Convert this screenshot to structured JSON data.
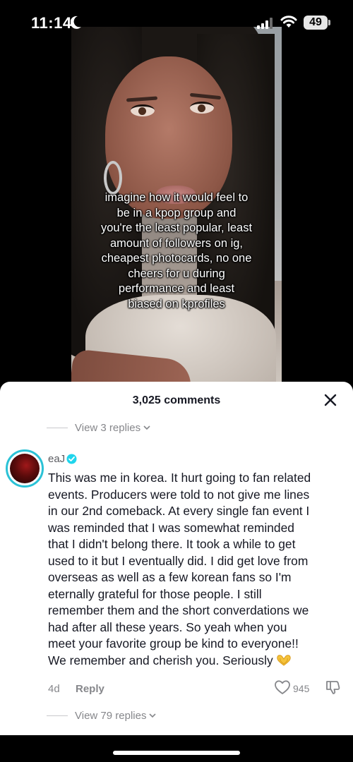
{
  "status_bar": {
    "time": "11:14",
    "battery": "49"
  },
  "video": {
    "caption_lines": [
      "imagine how it would feel to",
      "be in a kpop group and",
      "you're the least popular, least",
      "amount of followers on ig,",
      "cheapest photocards, no one",
      "cheers for u during",
      "performance and least",
      "biased on kprofiles"
    ]
  },
  "comments": {
    "title": "3,025 comments",
    "view_replies_top": "View 3 replies",
    "comment": {
      "username": "eaJ",
      "lines": [
        "This was me in korea. It hurt going to fan related",
        "events. Producers were told to not give me lines",
        "in our 2nd comeback. At every single fan event I",
        "was reminded that I was somewhat reminded",
        "that I didn't belong there. It took a while to get",
        "used to it but I eventually did. I did get love from",
        "overseas as well as a few korean fans so I'm",
        "eternally grateful for those people. I still",
        "remember them and the short converdations we",
        "had after all these years. So yeah when you",
        "meet your favorite group be kind to everyone!!",
        "We remember and cherish you. Seriously"
      ],
      "date": "4d",
      "reply_label": "Reply",
      "likes": "945",
      "view_replies": "View 79 replies"
    }
  },
  "icons": {
    "status": [
      "moon-icon",
      "signal-icon",
      "wifi-icon",
      "battery-icon"
    ],
    "sheet": [
      "close-icon",
      "verified-icon",
      "heart-icon",
      "dislike-icon",
      "heart-hands-emoji"
    ]
  },
  "colors": {
    "avatar_ring": "#2bc2d6",
    "verified": "#20d5ec",
    "emoji": "#f5c33b"
  }
}
